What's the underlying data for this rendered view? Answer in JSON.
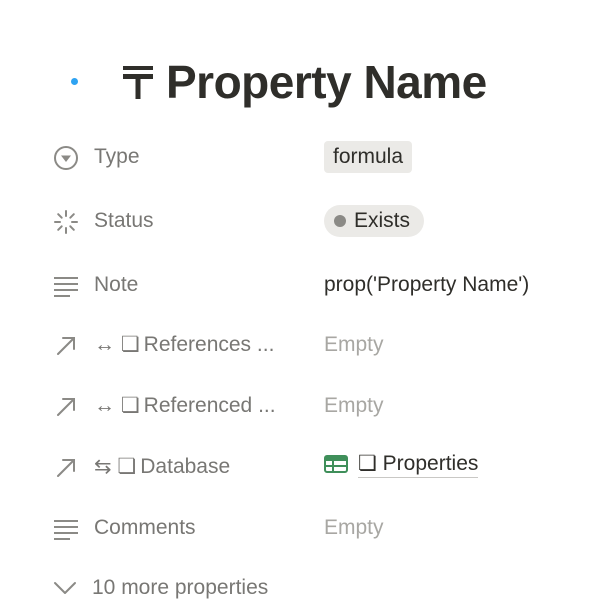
{
  "page": {
    "title": "Property Name",
    "title_icon": "text-t-icon"
  },
  "properties": [
    {
      "label": "Type",
      "icon": "chevron-circle-icon",
      "value": "formula",
      "value_style": "tag"
    },
    {
      "label": "Status",
      "icon": "loading-spinner-icon",
      "value": "Exists",
      "value_style": "status-pill",
      "status_color": "#8b8a86"
    },
    {
      "label": "Note",
      "icon": "text-lines-icon",
      "value": "prop('Property Name')",
      "value_style": "text"
    },
    {
      "label": "References ...",
      "prefix": "↔ ❏",
      "icon": "relation-arrow-icon",
      "value": "Empty",
      "value_style": "empty"
    },
    {
      "label": "Referenced ...",
      "prefix": "↔ ❏",
      "icon": "relation-arrow-icon",
      "value": "Empty",
      "value_style": "empty"
    },
    {
      "label": "Database",
      "prefix": "⇆ ❏",
      "icon": "relation-arrow-icon",
      "value": "❏ Properties",
      "value_icon": "table-icon",
      "value_style": "link"
    },
    {
      "label": "Comments",
      "icon": "text-lines-icon",
      "value": "Empty",
      "value_style": "empty"
    }
  ],
  "more_properties": {
    "label": "10 more properties",
    "icon": "chevron-down-icon"
  },
  "colors": {
    "accent_dot": "#2ea3f2",
    "label_gray": "#787774",
    "empty_gray": "#a8a7a3",
    "tag_bg": "#ebeae7",
    "table_icon_green": "#3f8f5a"
  }
}
